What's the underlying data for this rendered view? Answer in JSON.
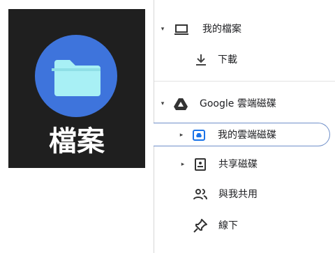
{
  "app": {
    "label": "檔案",
    "icon": "folder-icon",
    "colors": {
      "tile_bg": "#1f1f1f",
      "circle": "#3e74dc",
      "folder": "#a8f0f5"
    }
  },
  "nav": {
    "items": [
      {
        "label": "我的檔案",
        "icon": "laptop-icon",
        "arrow": "▾"
      },
      {
        "label": "下載",
        "icon": "download-icon"
      },
      {
        "label": "Google 雲端磁碟",
        "icon": "google-drive-icon",
        "arrow": "▾"
      },
      {
        "label": "我的雲端磁碟",
        "icon": "my-drive-icon",
        "arrow": "▸",
        "selected": true
      },
      {
        "label": "共享磁碟",
        "icon": "shared-drive-icon",
        "arrow": "▸"
      },
      {
        "label": "與我共用",
        "icon": "people-icon"
      },
      {
        "label": "線下",
        "icon": "pin-icon"
      }
    ]
  }
}
